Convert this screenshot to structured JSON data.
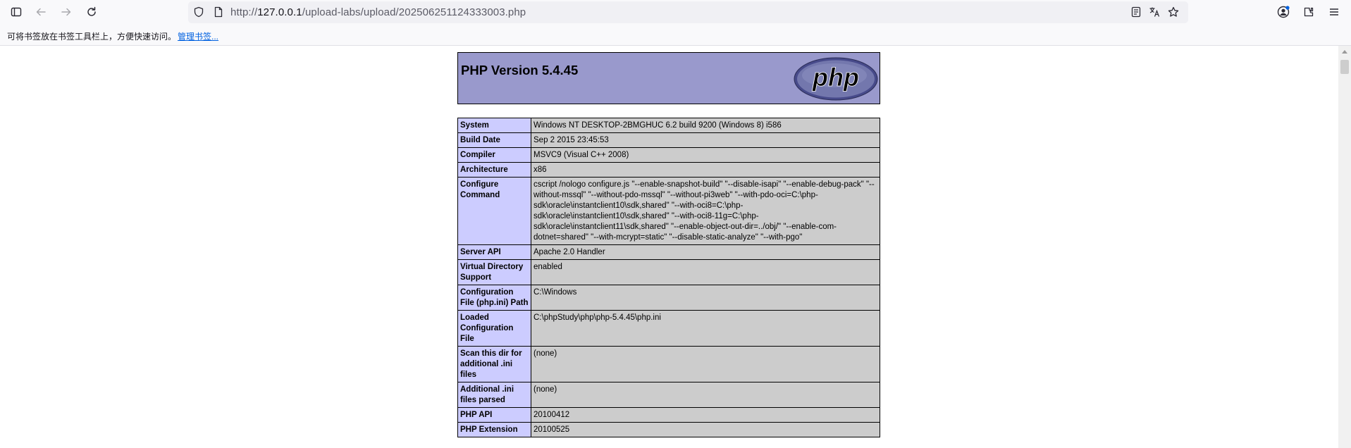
{
  "browser": {
    "url_prefix": "http://",
    "url_host": "127.0.0.1",
    "url_path": "/upload-labs/upload/202506251124333003.php",
    "bookmarks_hint": "可将书签放在书签工具栏上，方便快速访问。",
    "bookmarks_manage": "管理书签..."
  },
  "phpinfo": {
    "title": "PHP Version 5.4.45",
    "logo_text": "php",
    "rows": [
      {
        "key": "System",
        "value": "Windows NT DESKTOP-2BMGHUC 6.2 build 9200 (Windows 8) i586"
      },
      {
        "key": "Build Date",
        "value": "Sep 2 2015 23:45:53"
      },
      {
        "key": "Compiler",
        "value": "MSVC9 (Visual C++ 2008)"
      },
      {
        "key": "Architecture",
        "value": "x86"
      },
      {
        "key": "Configure Command",
        "value": "cscript /nologo configure.js \"--enable-snapshot-build\" \"--disable-isapi\" \"--enable-debug-pack\" \"--without-mssql\" \"--without-pdo-mssql\" \"--without-pi3web\" \"--with-pdo-oci=C:\\php-sdk\\oracle\\instantclient10\\sdk,shared\" \"--with-oci8=C:\\php-sdk\\oracle\\instantclient10\\sdk,shared\" \"--with-oci8-11g=C:\\php-sdk\\oracle\\instantclient11\\sdk,shared\" \"--enable-object-out-dir=../obj/\" \"--enable-com-dotnet=shared\" \"--with-mcrypt=static\" \"--disable-static-analyze\" \"--with-pgo\""
      },
      {
        "key": "Server API",
        "value": "Apache 2.0 Handler"
      },
      {
        "key": "Virtual Directory Support",
        "value": "enabled"
      },
      {
        "key": "Configuration File (php.ini) Path",
        "value": "C:\\Windows"
      },
      {
        "key": "Loaded Configuration File",
        "value": "C:\\phpStudy\\php\\php-5.4.45\\php.ini"
      },
      {
        "key": "Scan this dir for additional .ini files",
        "value": "(none)"
      },
      {
        "key": "Additional .ini files parsed",
        "value": "(none)"
      },
      {
        "key": "PHP API",
        "value": "20100412"
      },
      {
        "key": "PHP Extension",
        "value": "20100525"
      }
    ]
  },
  "colors": {
    "header_bg": "#9999cc",
    "key_bg": "#ccccff",
    "value_bg": "#cccccc"
  }
}
